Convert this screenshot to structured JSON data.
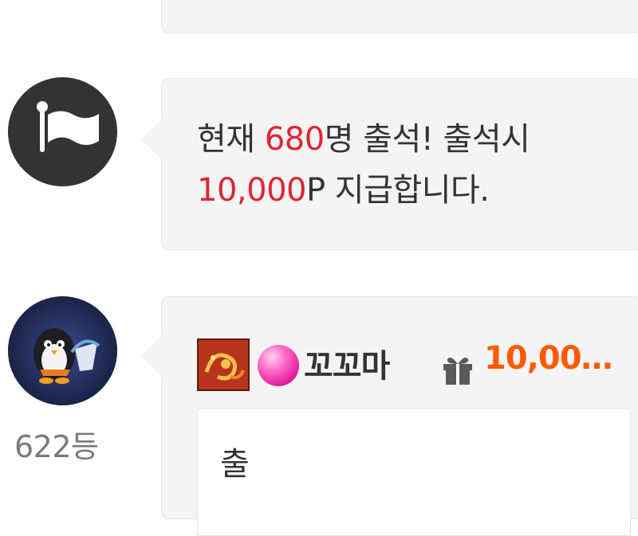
{
  "attendance": {
    "prefix": "현재 ",
    "count": "680",
    "mid": "명 출석! 출석시",
    "points": "10,000",
    "suffix": "P 지급합니다."
  },
  "entry": {
    "rank": "622등",
    "nickname": "꼬꼬마",
    "points": "10,00…",
    "comment": "출"
  },
  "icons": {
    "attendance": "flag-icon",
    "user_avatar": "penguin-avatar",
    "level_badge": "dragon-badge-icon",
    "grade": "pink-gem-icon",
    "gift": "gift-icon"
  },
  "colors": {
    "highlight_red": "#e0242f",
    "points_orange": "#ff5a00",
    "bubble_bg": "#f4f4f4"
  }
}
